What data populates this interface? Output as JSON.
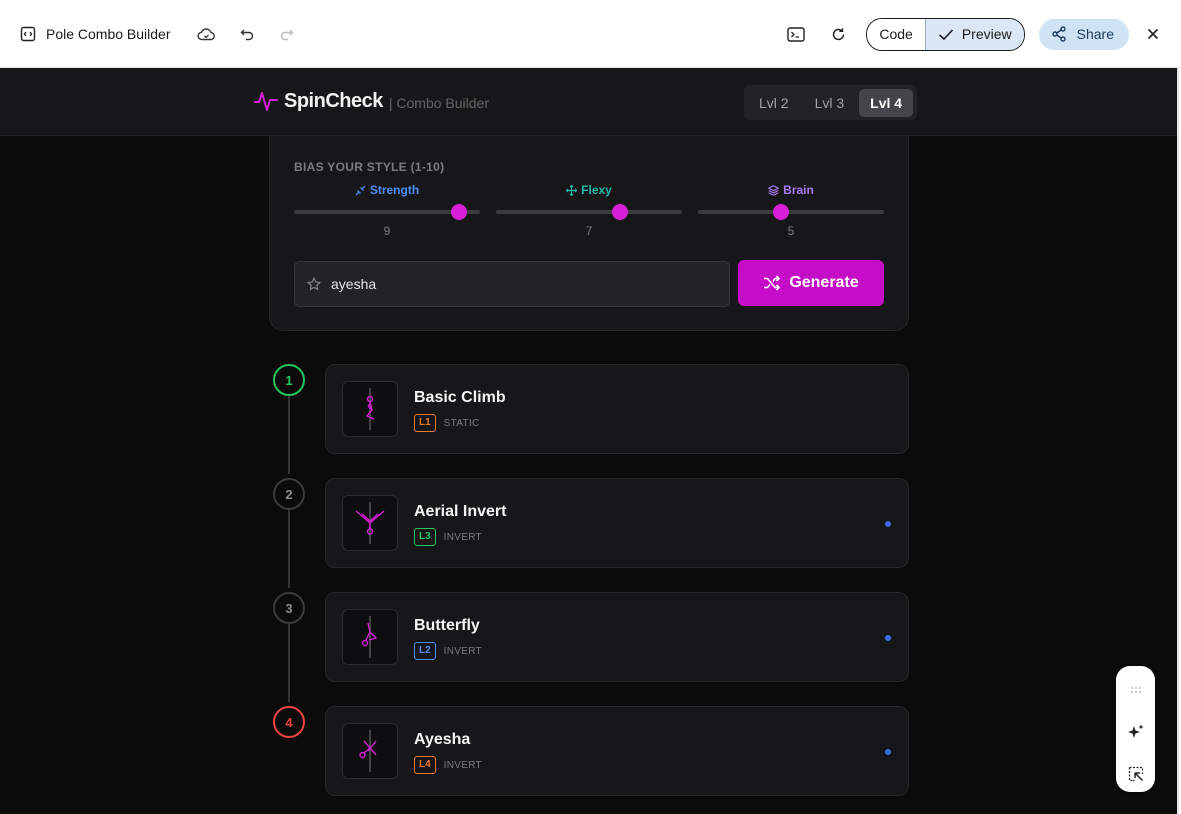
{
  "topbar": {
    "title": "Pole Combo Builder",
    "code_label": "Code",
    "preview_label": "Preview",
    "share_label": "Share"
  },
  "app": {
    "brand": "SpinCheck",
    "brand_sub": "| Combo Builder",
    "levels": [
      "Lvl 2",
      "Lvl 3",
      "Lvl 4"
    ],
    "active_level": "Lvl 4"
  },
  "bias": {
    "title": "BIAS YOUR STYLE (1-10)",
    "sliders": [
      {
        "label": "Strength",
        "value": "9",
        "level": 9,
        "color": "#4d8df5",
        "icon": "strength-icon"
      },
      {
        "label": "Flexy",
        "value": "7",
        "level": 7,
        "color": "#1fb8a8",
        "icon": "move-arrows-icon"
      },
      {
        "label": "Brain",
        "value": "5",
        "level": 5,
        "color": "#a978f0",
        "icon": "layers-icon"
      }
    ]
  },
  "name_input": {
    "value": "ayesha",
    "icon": "star-icon"
  },
  "generate": {
    "label": "Generate",
    "icon": "shuffle-icon"
  },
  "moves": [
    {
      "step": "1",
      "name": "Basic Climb",
      "level": "L1",
      "type": "STATIC",
      "level_color": "#f07a2a",
      "step_style": "green",
      "dot": false
    },
    {
      "step": "2",
      "name": "Aerial Invert",
      "level": "L3",
      "type": "INVERT",
      "level_color": "#22c55e",
      "step_style": "default",
      "dot": true
    },
    {
      "step": "3",
      "name": "Butterfly",
      "level": "L2",
      "type": "INVERT",
      "level_color": "#4d8df5",
      "step_style": "default",
      "dot": true
    },
    {
      "step": "4",
      "name": "Ayesha",
      "level": "L4",
      "type": "INVERT",
      "level_color": "#f07a2a",
      "step_style": "red",
      "dot": true
    }
  ],
  "colors": {
    "accent": "#c50dc8",
    "background": "#0b0b0b",
    "card": "#17171a"
  }
}
